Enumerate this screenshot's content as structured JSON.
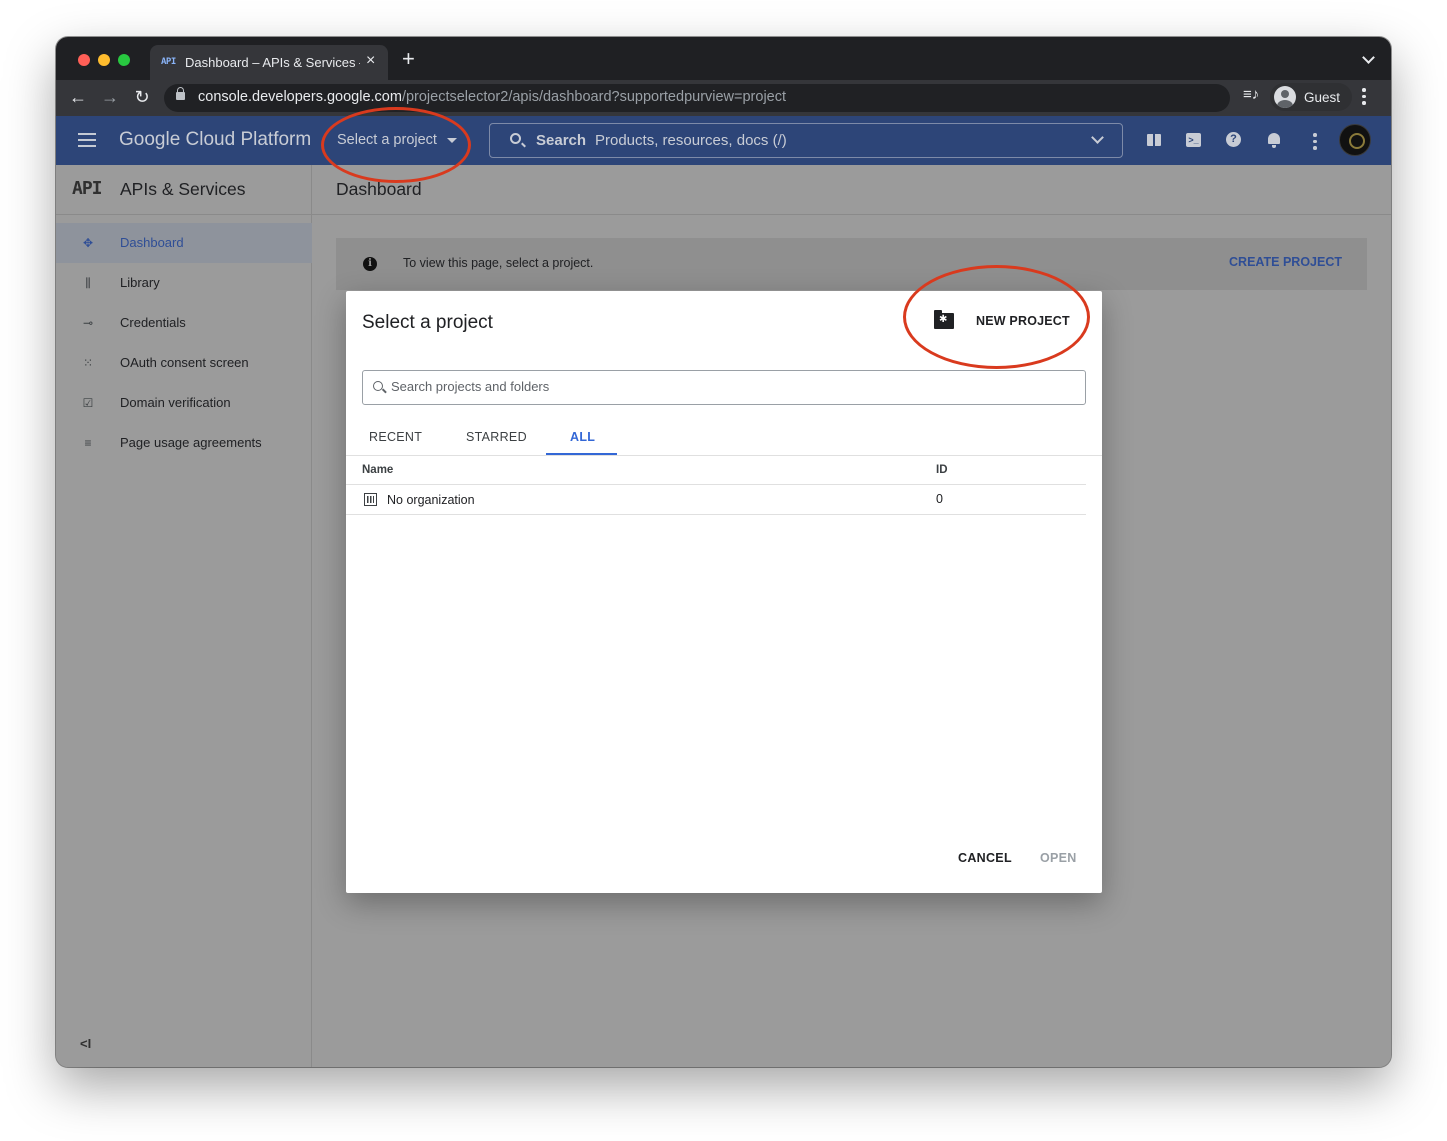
{
  "browser": {
    "tab_favicon": "API",
    "tab_title": "Dashboard – APIs & Services –",
    "tab_close": "×",
    "new_tab": "+",
    "url_host": "console.developers.google.com",
    "url_path": "/projectselector2/apis/dashboard?supportedpurview=project",
    "profile_name": "Guest"
  },
  "header": {
    "logo": "Google Cloud Platform",
    "project_selector": "Select a project",
    "search_label": "Search",
    "search_placeholder": "Products, resources, docs (/)",
    "shell_glyph": ">_",
    "help_glyph": "?"
  },
  "sidebar": {
    "logo": "API",
    "title": "APIs & Services",
    "items": [
      {
        "label": "Dashboard",
        "icon": "dashboard-icon",
        "glyph": "✥",
        "active": true
      },
      {
        "label": "Library",
        "icon": "library-icon",
        "glyph": "⫼",
        "active": false
      },
      {
        "label": "Credentials",
        "icon": "key-icon",
        "glyph": "⊸",
        "active": false
      },
      {
        "label": "OAuth consent screen",
        "icon": "consent-icon",
        "glyph": "⁙",
        "active": false
      },
      {
        "label": "Domain verification",
        "icon": "checkbox-icon",
        "glyph": "☑",
        "active": false
      },
      {
        "label": "Page usage agreements",
        "icon": "settings-list-icon",
        "glyph": "≡",
        "active": false
      }
    ],
    "collapse": "<I"
  },
  "main": {
    "title": "Dashboard",
    "banner_text": "To view this page, select a project.",
    "banner_info_glyph": "i",
    "banner_link": "CREATE PROJECT"
  },
  "dialog": {
    "title": "Select a project",
    "new_project": "NEW PROJECT",
    "search_placeholder": "Search projects and folders",
    "tabs": [
      "RECENT",
      "STARRED",
      "ALL"
    ],
    "active_tab": "ALL",
    "columns": {
      "name": "Name",
      "id": "ID"
    },
    "rows": [
      {
        "name": "No organization",
        "id": "0"
      }
    ],
    "cancel": "CANCEL",
    "open": "OPEN"
  },
  "colors": {
    "header_bg": "#2d4578",
    "accent": "#3367d6",
    "annotation": "#d93a1e"
  }
}
